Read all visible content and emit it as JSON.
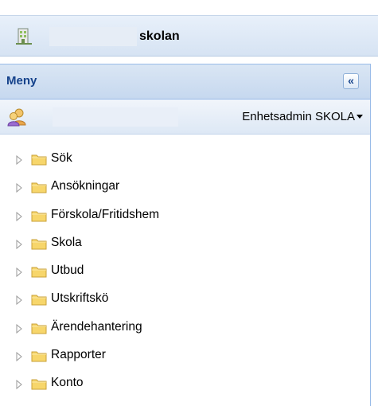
{
  "header": {
    "school_name": "skolan",
    "school_icon": "building-icon"
  },
  "menu": {
    "title": "Meny",
    "collapse_icon": "double-chevron-left-icon",
    "collapse_symbol": "«"
  },
  "user": {
    "icon": "users-icon",
    "role_label": "Enhetsadmin SKOLA"
  },
  "tree": {
    "items": [
      {
        "label": "Sök"
      },
      {
        "label": "Ansökningar"
      },
      {
        "label": "Förskola/Fritidshem"
      },
      {
        "label": "Skola"
      },
      {
        "label": "Utbud"
      },
      {
        "label": "Utskriftskö"
      },
      {
        "label": "Ärendehantering"
      },
      {
        "label": "Rapporter"
      },
      {
        "label": "Konto"
      }
    ],
    "expand_icon": "triangle-right-icon",
    "folder_icon": "folder-icon"
  },
  "colors": {
    "panel_title": "#15428b",
    "panel_border": "#99bbe8",
    "folder_fill": "#f7d66b",
    "folder_stroke": "#c9a13a"
  }
}
